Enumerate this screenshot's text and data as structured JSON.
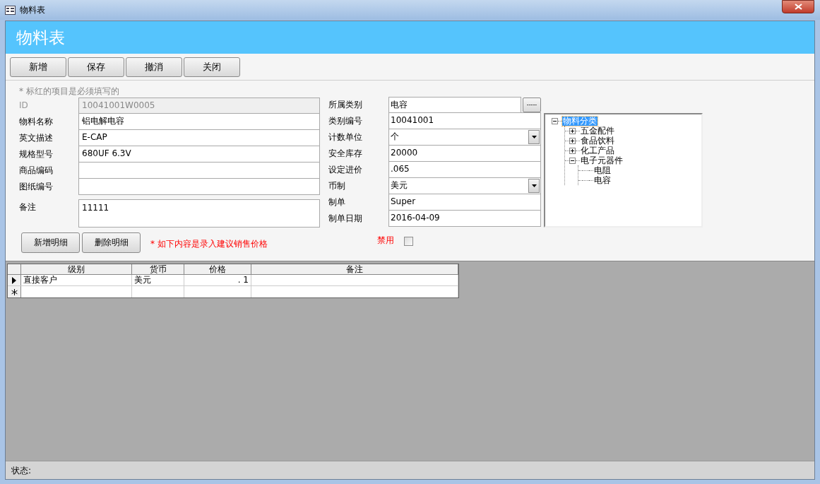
{
  "window": {
    "title": "物料表"
  },
  "header": {
    "title": "物料表"
  },
  "toolbar": [
    "新增",
    "保存",
    "撤消",
    "关闭"
  ],
  "required_note": "* 标红的项目是必须填写的",
  "left_fields": [
    {
      "label": "ID",
      "value": "10041001W0005",
      "kind": "text",
      "disabled": true
    },
    {
      "label": "物料名称",
      "value": "铝电解电容",
      "kind": "text",
      "disabled": false
    },
    {
      "label": "英文描述",
      "value": "E-CAP",
      "kind": "text",
      "disabled": false
    },
    {
      "label": "规格型号",
      "value": "680UF 6.3V",
      "kind": "text",
      "disabled": false
    },
    {
      "label": "商品编码",
      "kind": "text",
      "disabled": false
    },
    {
      "label": "图纸编号",
      "kind": "text",
      "disabled": false
    },
    {
      "label": "备注",
      "value": "11111",
      "kind": "multiline",
      "disabled": false
    }
  ],
  "right_fields": [
    {
      "label": "所属类别",
      "value": "电容",
      "kind": "lookup",
      "button": "-----"
    },
    {
      "label": "类别编号",
      "value": "10041001",
      "kind": "text"
    },
    {
      "label": "计数单位",
      "value": "个",
      "kind": "dropdown"
    },
    {
      "label": "安全库存",
      "value": "20000",
      "kind": "text"
    },
    {
      "label": "设定进价",
      "value": ".065",
      "kind": "text"
    },
    {
      "label": "币制",
      "value": "美元",
      "kind": "dropdown"
    },
    {
      "label": "制单",
      "value": "Super",
      "kind": "text"
    },
    {
      "label": "制单日期",
      "value": "2016-04-09",
      "kind": "text"
    }
  ],
  "tree": [
    {
      "label": "物料分类",
      "expanded": true,
      "selected": true,
      "children": [
        {
          "label": "五金配件",
          "expanded": false,
          "selected": false
        },
        {
          "label": "食品饮料",
          "expanded": false,
          "selected": false
        },
        {
          "label": "化工产品",
          "expanded": false,
          "selected": false
        },
        {
          "label": "电子元器件",
          "expanded": true,
          "selected": false,
          "children": [
            {
              "label": "电阻",
              "selected": false
            },
            {
              "label": "电容",
              "selected": false
            }
          ]
        }
      ]
    }
  ],
  "detail_buttons": [
    "新增明细",
    "删除明细"
  ],
  "price_note": "* 如下内容是录入建议销售价格",
  "disabled_checkbox": {
    "label": "禁用",
    "checked": false
  },
  "grid": {
    "columns": [
      "级别",
      "货币",
      "价格",
      "备注"
    ],
    "rows": [
      {
        "cells": [
          "直接客户",
          "美元",
          ". 1",
          ""
        ],
        "current": true
      }
    ],
    "new_row": true
  },
  "status_bar": {
    "label": "状态:"
  }
}
